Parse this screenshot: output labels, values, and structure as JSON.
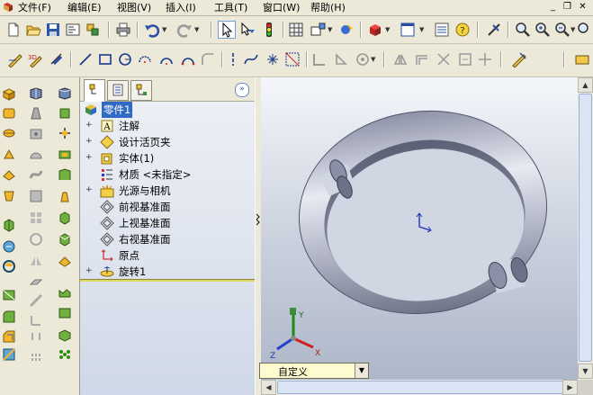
{
  "menubar": {
    "items": [
      "文件(F)",
      "编辑(E)",
      "视图(V)",
      "插入(I)",
      "工具(T)",
      "窗口(W)",
      "帮助(H)"
    ],
    "window_controls": [
      "minimize-icon",
      "restore-icon",
      "close-icon"
    ]
  },
  "feature_manager": {
    "tabs": [
      "feature-manager-tab",
      "property-manager-tab",
      "configuration-manager-tab"
    ],
    "expand_label": "»",
    "tree": [
      {
        "label": "零件1",
        "icon": "part-icon",
        "expander": ""
      },
      {
        "label": "注解",
        "icon": "annotations-icon",
        "expander": "+"
      },
      {
        "label": "设计活页夹",
        "icon": "design-binder-icon",
        "expander": "+"
      },
      {
        "label": "实体(1)",
        "icon": "solid-bodies-icon",
        "expander": "+"
      },
      {
        "label": "材质 <未指定>",
        "icon": "material-icon",
        "expander": ""
      },
      {
        "label": "光源与相机",
        "icon": "lights-cameras-icon",
        "expander": "+"
      },
      {
        "label": "前视基准面",
        "icon": "plane-icon",
        "expander": ""
      },
      {
        "label": "上视基准面",
        "icon": "plane-icon",
        "expander": ""
      },
      {
        "label": "右视基准面",
        "icon": "plane-icon",
        "expander": ""
      },
      {
        "label": "原点",
        "icon": "origin-icon",
        "expander": ""
      },
      {
        "label": "旋转1",
        "icon": "revolve-feature-icon",
        "expander": "+"
      }
    ]
  },
  "graphics": {
    "view_selector": "自定义",
    "triad_labels": [
      "Y",
      "Z",
      "X"
    ]
  },
  "colors": {
    "selection": "#316ac5",
    "model": "#b9bccb",
    "background_top": "#f4f6fa",
    "background_bottom": "#aeb7c9"
  }
}
